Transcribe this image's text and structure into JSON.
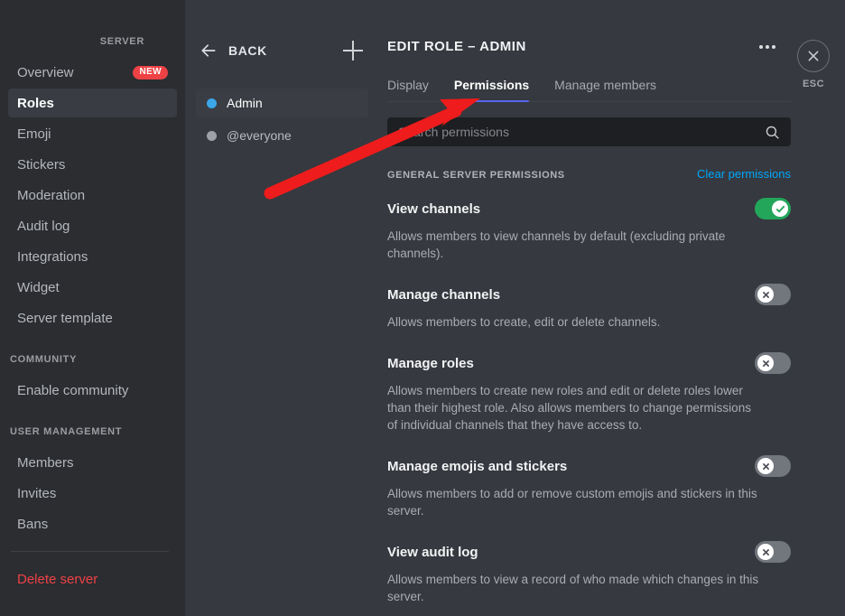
{
  "sidebar": {
    "groups": [
      {
        "title": "SERVER",
        "items": [
          {
            "label": "Overview",
            "badge": "NEW",
            "active": false
          },
          {
            "label": "Roles",
            "badge": "",
            "active": true
          },
          {
            "label": "Emoji",
            "badge": "",
            "active": false
          },
          {
            "label": "Stickers",
            "badge": "",
            "active": false
          },
          {
            "label": "Moderation",
            "badge": "",
            "active": false
          },
          {
            "label": "Audit log",
            "badge": "",
            "active": false
          },
          {
            "label": "Integrations",
            "badge": "",
            "active": false
          },
          {
            "label": "Widget",
            "badge": "",
            "active": false
          },
          {
            "label": "Server template",
            "badge": "",
            "active": false
          }
        ]
      },
      {
        "title": "COMMUNITY",
        "items": [
          {
            "label": "Enable community",
            "badge": "",
            "active": false
          }
        ]
      },
      {
        "title": "USER MANAGEMENT",
        "items": [
          {
            "label": "Members",
            "badge": "",
            "active": false
          },
          {
            "label": "Invites",
            "badge": "",
            "active": false
          },
          {
            "label": "Bans",
            "badge": "",
            "active": false
          }
        ]
      }
    ],
    "danger_item": "Delete server"
  },
  "roles_panel": {
    "back_label": "BACK",
    "add_role_tooltip": "Create role",
    "roles": [
      {
        "name": "Admin",
        "color": "#3ba6e8",
        "active": true
      },
      {
        "name": "@everyone",
        "color": "#9ea1a6",
        "active": false
      }
    ]
  },
  "main": {
    "title": "EDIT ROLE – ADMIN",
    "tabs": [
      {
        "label": "Display",
        "active": false
      },
      {
        "label": "Permissions",
        "active": true
      },
      {
        "label": "Manage members",
        "active": false
      }
    ],
    "search": {
      "value": "",
      "placeholder": "Search permissions"
    },
    "section_title": "GENERAL SERVER PERMISSIONS",
    "clear_label": "Clear permissions",
    "permissions": [
      {
        "name": "View channels",
        "description": "Allows members to view channels by default (excluding private channels).",
        "enabled": true
      },
      {
        "name": "Manage channels",
        "description": "Allows members to create, edit or delete channels.",
        "enabled": false
      },
      {
        "name": "Manage roles",
        "description": "Allows members to create new roles and edit or delete roles lower than their highest role. Also allows members to change permissions of individual channels that they have access to.",
        "enabled": false
      },
      {
        "name": "Manage emojis and stickers",
        "description": "Allows members to add or remove custom emojis and stickers in this server.",
        "enabled": false
      },
      {
        "name": "View audit log",
        "description": "Allows members to view a record of who made which changes in this server.",
        "enabled": false
      }
    ]
  },
  "close": {
    "label": "ESC"
  },
  "annotation": {
    "type": "arrow",
    "color": "#ee1c1c",
    "points_at": "Permissions"
  },
  "colors": {
    "sidebar_bg": "#2b2d31",
    "main_bg": "#36393f",
    "accent_blurple": "#5865f2",
    "toggle_on": "#23a55a",
    "toggle_off": "#72767d",
    "link_blue": "#00a8fc",
    "danger_red": "#ed4245",
    "badge_red": "#ed4245"
  }
}
